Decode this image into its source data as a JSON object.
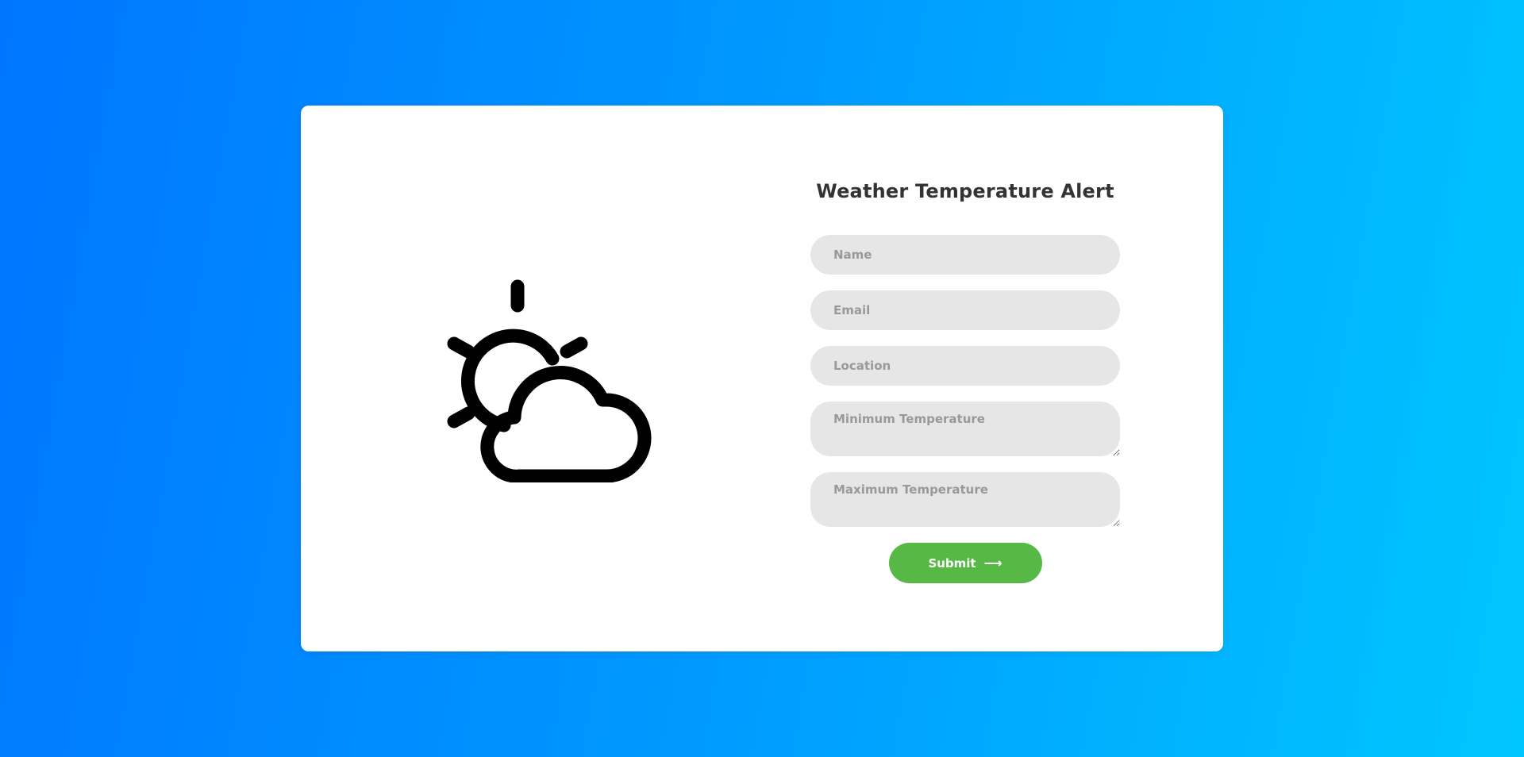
{
  "form": {
    "title": "Weather Temperature Alert",
    "fields": {
      "name": {
        "placeholder": "Name",
        "value": ""
      },
      "email": {
        "placeholder": "Email",
        "value": ""
      },
      "location": {
        "placeholder": "Location",
        "value": ""
      },
      "min_temp": {
        "placeholder": "Minimum Temperature",
        "value": ""
      },
      "max_temp": {
        "placeholder": "Maximum Temperature",
        "value": ""
      }
    },
    "submit_label": "Submit",
    "submit_arrow": "⟶"
  },
  "illustration": {
    "icon": "partly-cloudy-icon"
  },
  "colors": {
    "background_start": "#0076ff",
    "background_end": "#00c6ff",
    "card": "#ffffff",
    "field_bg": "#e6e6e6",
    "button": "#57b846",
    "title": "#333333"
  }
}
